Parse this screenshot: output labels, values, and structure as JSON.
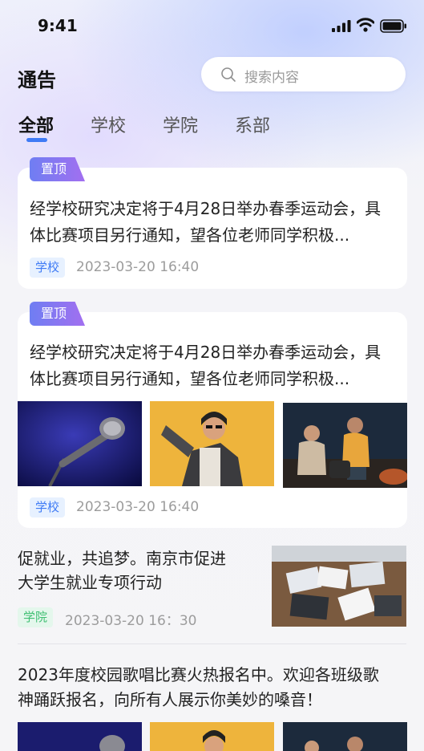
{
  "status_bar": {
    "time": "9:41"
  },
  "header": {
    "title": "通告",
    "search_placeholder": "搜索内容"
  },
  "tabs": [
    {
      "label": "全部",
      "active": true
    },
    {
      "label": "学校"
    },
    {
      "label": "学院"
    },
    {
      "label": "系部"
    }
  ],
  "posts": [
    {
      "pinned": "置顶",
      "text_line1": "经学校研究决定将于4月28日举办春季运动会，具",
      "text_line2": "体比赛项目另行通知，望各位老师同学积极...",
      "tag": "学校",
      "date": "2023-03-20 16:40"
    },
    {
      "pinned": "置顶",
      "text_line1": "经学校研究决定将于4月28日举办春季运动会，具",
      "text_line2": "体比赛项目另行通知，望各位老师同学积极...",
      "images": [
        "microphone-photo",
        "singer-photo",
        "campfire-singing-photo"
      ],
      "tag": "学校",
      "date": "2023-03-20 16:40"
    },
    {
      "text_line1": "促就业，共追梦。南京市促进",
      "text_line2": "大学生就业专项行动",
      "image": "meeting-laptops-photo",
      "tag": "学院",
      "date": "2023-03-20 16：30"
    },
    {
      "text_line1": "2023年度校园歌唱比赛火热报名中。欢迎各班级歌",
      "text_line2": "神踊跃报名，向所有人展示你美妙的嗓音！",
      "images": [
        "microphone-photo",
        "singer-photo",
        "campfire-singing-photo"
      ]
    }
  ],
  "colors": {
    "accent": "#3f7bf5",
    "pin_start": "#6f7ef2",
    "pin_end": "#a26ff0",
    "college_tag": "#3fbf72"
  }
}
